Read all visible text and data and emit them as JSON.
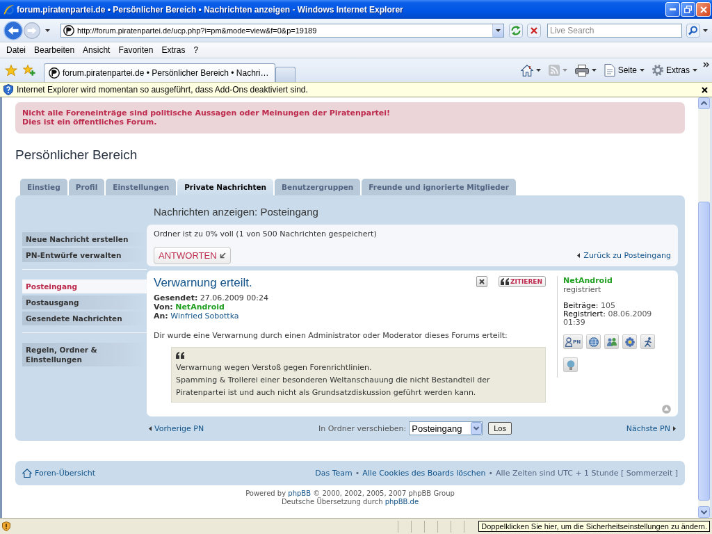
{
  "window": {
    "title": "forum.piratenpartei.de • Persönlicher Bereich • Nachrichten anzeigen - Windows Internet Explorer"
  },
  "address_bar": {
    "url": "http://forum.piratenpartei.de/ucp.php?i=pm&mode=view&f=0&p=19189",
    "search_placeholder": "Live Search"
  },
  "menu": [
    "Datei",
    "Bearbeiten",
    "Ansicht",
    "Favoriten",
    "Extras",
    "?"
  ],
  "browser_tabs": [
    {
      "label": "forum.piratenpartei.de • Persönlicher Bereich • Nachri…",
      "selected": true
    }
  ],
  "command_bar": [
    {
      "kind": "home",
      "disabled": false
    },
    {
      "kind": "feeds",
      "disabled": true
    },
    {
      "kind": "print",
      "disabled": false
    },
    {
      "kind": "page",
      "label": "Seite",
      "disabled": false
    },
    {
      "kind": "tools",
      "label": "Extras",
      "disabled": false
    }
  ],
  "info_bar": {
    "text": "Internet Explorer wird momentan so ausgeführt, dass Add-Ons deaktiviert sind."
  },
  "notice": [
    "Nicht alle Foreneinträge sind politische Aussagen oder Meinungen der Piratenpartei!",
    "Dies ist ein öffentliches Forum."
  ],
  "page_title": "Persönlicher Bereich",
  "tabs": [
    {
      "label": "Einstieg",
      "selected": false
    },
    {
      "label": "Profil",
      "selected": false
    },
    {
      "label": "Einstellungen",
      "selected": false
    },
    {
      "label": "Private Nachrichten",
      "selected": true
    },
    {
      "label": "Benutzergruppen",
      "selected": false
    },
    {
      "label": "Freunde und ignorierte Mitglieder",
      "selected": false
    }
  ],
  "sidebar": {
    "groups": [
      {
        "items": [
          {
            "label": "Neue Nachricht erstellen",
            "selected": false
          },
          {
            "label": "PN-Entwürfe verwalten",
            "selected": false
          }
        ]
      },
      {
        "items": [
          {
            "label": "Posteingang",
            "selected": true
          },
          {
            "label": "Postausgang",
            "selected": false
          },
          {
            "label": "Gesendete Nachrichten",
            "selected": false
          }
        ]
      },
      {
        "items": [
          {
            "label": "Regeln, Ordner & Einstellungen",
            "selected": false
          }
        ]
      }
    ]
  },
  "panel": {
    "heading": "Nachrichten anzeigen: Posteingang",
    "folder_status": "Ordner ist zu 0% voll (1 von 500 Nachrichten gespeichert)",
    "reply_button": "ANTWORTEN",
    "back_link": "Zurück zu Posteingang"
  },
  "message": {
    "subject": "Verwarnung erteilt.",
    "quote_button": "ZITIEREN",
    "meta": [
      {
        "kind": "date",
        "label": "Gesendet:",
        "value": "27.06.2009 00:24"
      },
      {
        "kind": "user",
        "label": "Von:",
        "value": "NetAndroid"
      },
      {
        "kind": "link",
        "label": "An:",
        "value": "Winfried Sobottka"
      }
    ],
    "intro": "Dir wurde eine Verwarnung durch einen Administrator oder Moderator dieses Forums erteilt:",
    "quote": [
      "Verwarnung wegen Verstoß gegen Forenrichtlinien.",
      "Spamming & Trollerei einer besonderen Weltanschauung die nicht Bestandteil der Piratenpartei ist und auch nicht als Grundsatzdiskussion geführt werden kann."
    ]
  },
  "author": {
    "name": "NetAndroid",
    "rank": "registriert",
    "stats": [
      {
        "label": "Beiträge:",
        "value": "105"
      },
      {
        "label": "Registriert:",
        "value": "08.06.2009 01:39"
      }
    ],
    "contacts": [
      {
        "kind": "pm",
        "label": "PN"
      },
      {
        "kind": "globe"
      },
      {
        "kind": "people"
      },
      {
        "kind": "flower"
      },
      {
        "kind": "runner"
      },
      {
        "kind": "bulb"
      }
    ]
  },
  "pager": {
    "prev": "Vorherige PN",
    "move_label": "In Ordner verschieben:",
    "folder": "Posteingang",
    "go_button": "Los",
    "next": "Nächste PN"
  },
  "footer": {
    "home_link": "Foren-Übersicht",
    "items": [
      {
        "kind": "link",
        "text": "Das Team"
      },
      {
        "kind": "sep",
        "text": "•"
      },
      {
        "kind": "link",
        "text": "Alle Cookies des Boards löschen"
      },
      {
        "kind": "sep",
        "text": "•"
      },
      {
        "kind": "text",
        "text": "Alle Zeiten sind UTC + 1 Stunde [ Sommerzeit ]"
      }
    ]
  },
  "credits": [
    {
      "before": "Powered by ",
      "link": "phpBB",
      "after": " © 2000, 2002, 2005, 2007 phpBB Group"
    },
    {
      "before": "Deutsche Übersetzung durch ",
      "link": "phpBB.de"
    }
  ],
  "status_bar": {
    "tooltip": "Doppelklicken Sie hier, um die Sicherheitseinstellungen zu ändern."
  }
}
